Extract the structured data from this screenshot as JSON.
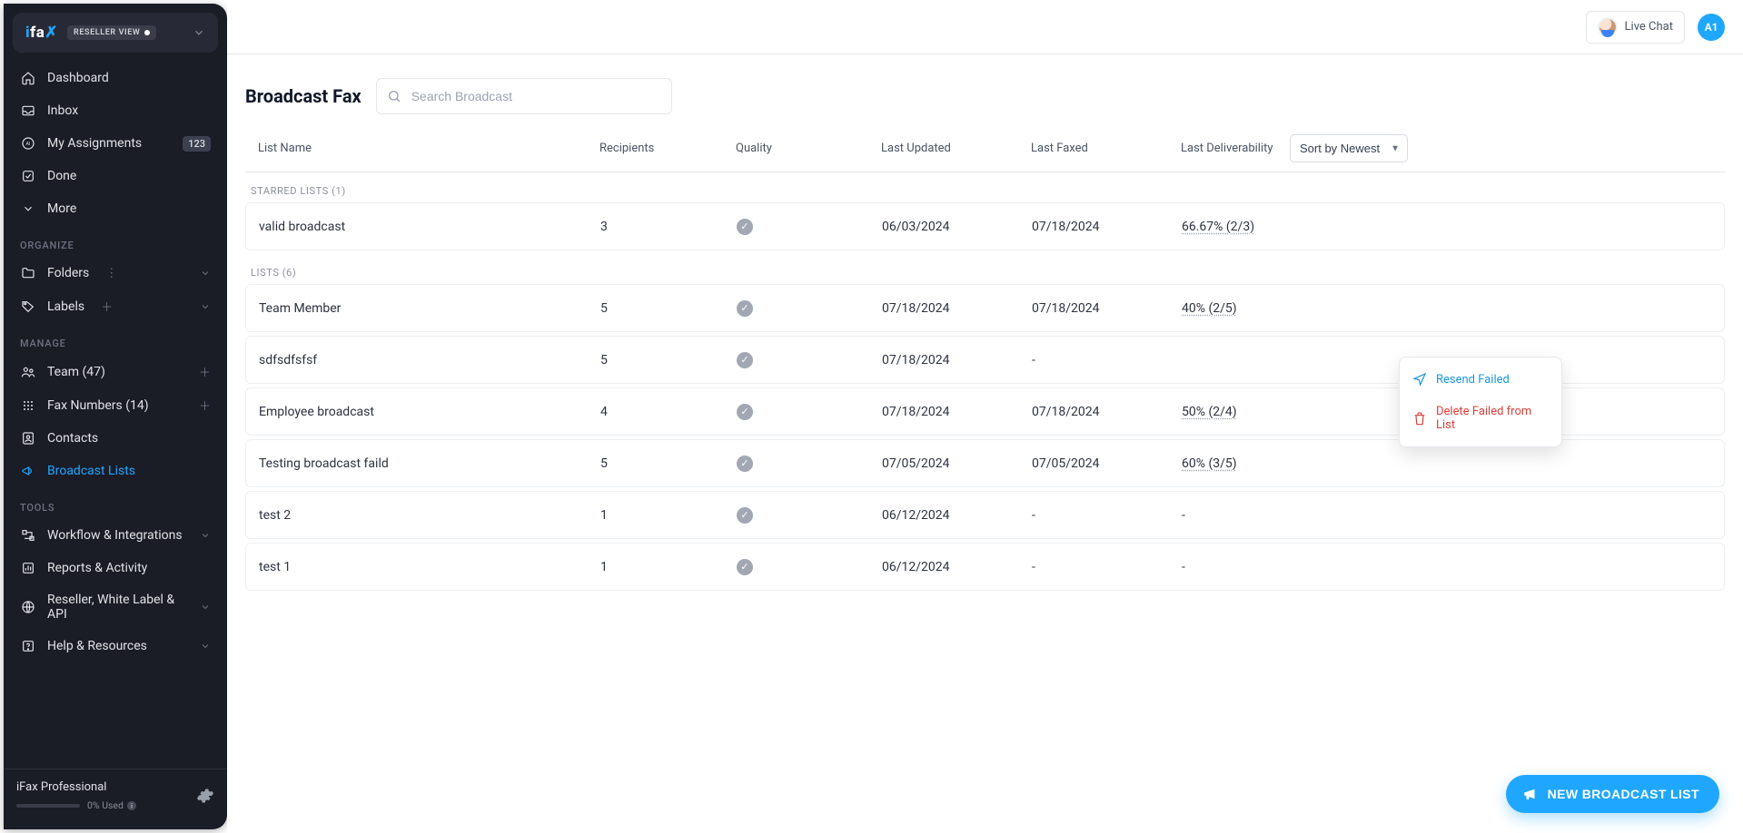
{
  "brand": {
    "name": "ifax",
    "badge": "RESELLER VIEW"
  },
  "sidebar": {
    "items": [
      {
        "label": "Dashboard"
      },
      {
        "label": "Inbox"
      },
      {
        "label": "My Assignments",
        "count": "123"
      },
      {
        "label": "Done"
      },
      {
        "label": "More"
      }
    ],
    "organize_label": "ORGANIZE",
    "organize": [
      {
        "label": "Folders"
      },
      {
        "label": "Labels"
      }
    ],
    "manage_label": "MANAGE",
    "manage": [
      {
        "label": "Team (47)"
      },
      {
        "label": "Fax Numbers (14)"
      },
      {
        "label": "Contacts"
      },
      {
        "label": "Broadcast Lists"
      }
    ],
    "tools_label": "TOOLS",
    "tools": [
      {
        "label": "Workflow & Integrations"
      },
      {
        "label": "Reports & Activity"
      },
      {
        "label": "Reseller, White Label & API"
      },
      {
        "label": "Help & Resources"
      }
    ]
  },
  "footer": {
    "plan": "iFax Professional",
    "usage": "0% Used"
  },
  "topbar": {
    "live_chat": "Live Chat",
    "avatar_initials": "A1"
  },
  "page": {
    "title": "Broadcast Fax",
    "search_placeholder": "Search Broadcast"
  },
  "table": {
    "headers": {
      "name": "List Name",
      "recipients": "Recipients",
      "quality": "Quality",
      "updated": "Last Updated",
      "faxed": "Last Faxed",
      "deliverability": "Last Deliverability"
    },
    "sort_label": "Sort by Newest",
    "group_starred": "STARRED LISTS (1)",
    "group_lists": "LISTS (6)",
    "starred": [
      {
        "name": "valid broadcast",
        "recipients": "3",
        "updated": "06/03/2024",
        "faxed": "07/18/2024",
        "deliverability": "66.67% (2/3)"
      }
    ],
    "lists": [
      {
        "name": "Team Member",
        "recipients": "5",
        "updated": "07/18/2024",
        "faxed": "07/18/2024",
        "deliverability": "40% (2/5)"
      },
      {
        "name": "sdfsdfsfsf",
        "recipients": "5",
        "updated": "07/18/2024",
        "faxed": "-",
        "deliverability": ""
      },
      {
        "name": "Employee broadcast",
        "recipients": "4",
        "updated": "07/18/2024",
        "faxed": "07/18/2024",
        "deliverability": "50% (2/4)"
      },
      {
        "name": "Testing broadcast faild",
        "recipients": "5",
        "updated": "07/05/2024",
        "faxed": "07/05/2024",
        "deliverability": "60% (3/5)"
      },
      {
        "name": "test 2",
        "recipients": "1",
        "updated": "06/12/2024",
        "faxed": "-",
        "deliverability": "-"
      },
      {
        "name": "test 1",
        "recipients": "1",
        "updated": "06/12/2024",
        "faxed": "-",
        "deliverability": "-"
      }
    ]
  },
  "context_menu": {
    "resend": "Resend Failed",
    "delete": "Delete Failed from List"
  },
  "fab": {
    "label": "NEW BROADCAST LIST"
  }
}
